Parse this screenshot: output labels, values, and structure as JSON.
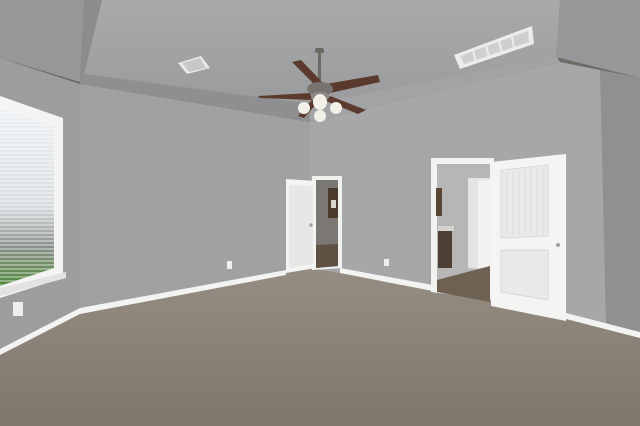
{
  "scene": {
    "kind": "photo",
    "subject": "empty-bedroom",
    "colors": {
      "wall_left": "#9c9d9e",
      "wall_back": "#a6a7a8",
      "wall_side": "#8f9091",
      "ceiling_center": "#a9aaab",
      "ceiling_edge": "#919293",
      "carpet": "#8a8278",
      "carpet_far": "#958d82",
      "trim": "#f3f3f1",
      "door": "#f4f4f2",
      "door_shadow": "#d6d6d4",
      "hall_floor": "#6e6151",
      "fan_blade": "#5a3a2c",
      "fan_metal": "#6d6a66",
      "glass": "#f2f0e8",
      "window_sky": "#e9edf1",
      "window_grass": "#4f8a3a"
    }
  }
}
